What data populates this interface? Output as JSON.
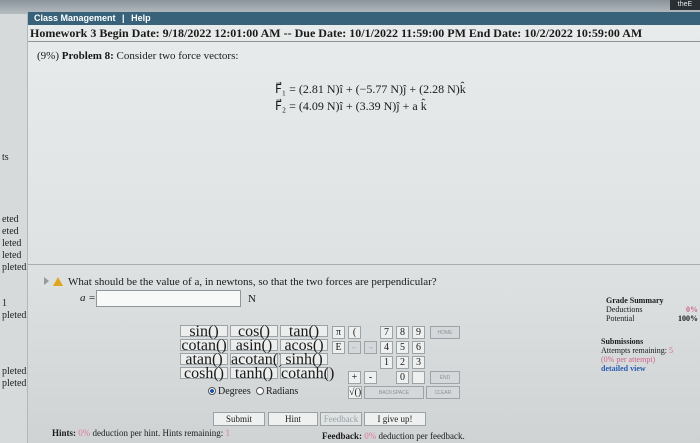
{
  "corner_badge": "theE",
  "menu": {
    "items": [
      "Class Management",
      "|",
      "Help"
    ]
  },
  "header": {
    "title": "Homework 3 Begin Date: 9/18/2022 12:01:00 AM -- Due Date: 10/1/2022 11:59:00 PM End Date: 10/2/2022 10:59:00 AM"
  },
  "sidebar": {
    "items": [
      "ts",
      "eted",
      "eted",
      "leted",
      "leted",
      "pleted",
      "1",
      "pleted",
      "pleted",
      "pleted"
    ]
  },
  "problem": {
    "weight": "(9%)",
    "label": "Problem 8:",
    "text": "Consider two force vectors:",
    "eq1": "F⃗₁ = (2.81 N)î + (−5.77 N)ĵ + (2.28 N)k̂",
    "eq2": "F⃗₂ = (4.09 N)î + (3.39 N)ĵ + a k̂"
  },
  "question": {
    "text": "What should be the value of a, in newtons, so that the two forces are perpendicular?",
    "input_label": "a =",
    "input_value": "",
    "unit": "N"
  },
  "calculator": {
    "functions": [
      [
        "sin()",
        "cos()",
        "tan()"
      ],
      [
        "cotan()",
        "asin()",
        "acos()"
      ],
      [
        "atan()",
        "acotan()",
        "sinh()"
      ],
      [
        "cosh()",
        "tanh()",
        "cotanh()"
      ]
    ],
    "pi": "π",
    "paren": "(",
    "e": "E",
    "keypad": [
      [
        "7",
        "8",
        "9"
      ],
      [
        "4",
        "5",
        "6"
      ],
      [
        "1",
        "2",
        "3"
      ],
      [
        "",
        "0",
        ""
      ]
    ],
    "plus": "+",
    "minus": "-",
    "sqrt": "√()",
    "home": "HOME",
    "end": "END",
    "backspace": "BACKSPACE",
    "clear": "CLEAR",
    "arrow_left": "←",
    "arrow_right": "→",
    "angle_modes": [
      "Degrees",
      "Radians"
    ],
    "selected_mode": "Degrees"
  },
  "actions": {
    "submit": "Submit",
    "hint": "Hint",
    "feedback": "Feedback",
    "give_up": "I give up!"
  },
  "hints_bar": {
    "label": "Hints:",
    "percent": "0%",
    "text": "deduction per hint. Hints remaining:",
    "remaining": "1"
  },
  "feedback_bar": {
    "label": "Feedback:",
    "percent": "0%",
    "text": "deduction per feedback."
  },
  "grade_summary": {
    "title": "Grade Summary",
    "deductions_label": "Deductions",
    "deductions_value": "0%",
    "potential_label": "Potential",
    "potential_value": "100%"
  },
  "submissions": {
    "title": "Submissions",
    "attempts_label": "Attempts remaining:",
    "attempts_value": "5",
    "per_attempt": "(0% per attempt)",
    "detailed_view": "detailed view"
  },
  "colors": {
    "menubar": "#37627a",
    "accent_pink": "#d1628a",
    "link_blue": "#2b5cb3"
  }
}
